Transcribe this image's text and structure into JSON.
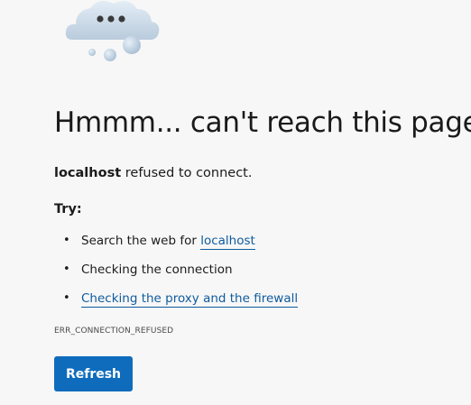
{
  "error": {
    "title": "Hmmm... can't reach this page",
    "host": "localhost",
    "message_suffix": " refused to connect.",
    "try_heading": "Try:",
    "suggestions": [
      {
        "prefix": "Search the web for ",
        "link": "localhost"
      },
      {
        "text": "Checking the connection"
      },
      {
        "link": "Checking the proxy and the firewall"
      }
    ],
    "code": "ERR_CONNECTION_REFUSED",
    "refresh_label": "Refresh"
  },
  "icons": {
    "illustration": "cloud-with-dots-icon"
  },
  "colors": {
    "background": "#f7f7f7",
    "link": "#0f5b9e",
    "button": "#0f6cbd"
  }
}
